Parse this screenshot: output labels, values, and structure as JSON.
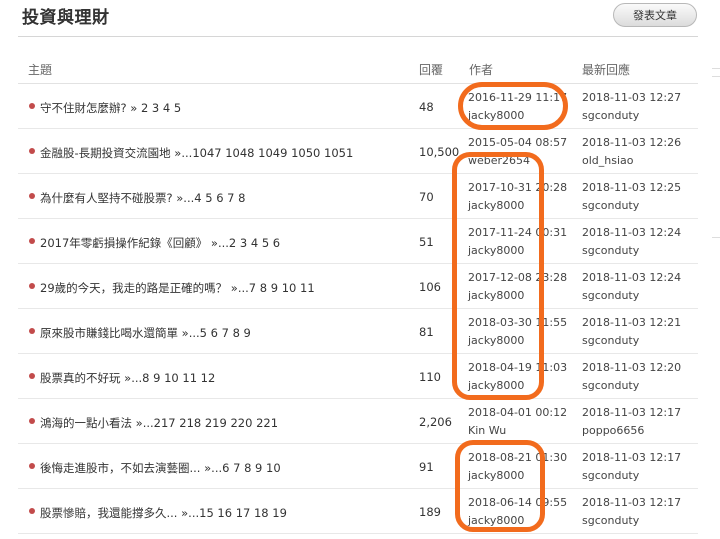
{
  "forum": {
    "title": "投資與理財",
    "post_button": "發表文章"
  },
  "columns": {
    "topic": "主題",
    "replies": "回覆",
    "author": "作者",
    "latest": "最新回應"
  },
  "threads": [
    {
      "title": "守不住財怎麼辦?",
      "pages": " » 2 3 4 5",
      "replies": "48",
      "author_date": "2016-11-29 11:17",
      "author": "jacky8000",
      "last_date": "2018-11-03 12:27",
      "last_user": "sgconduty"
    },
    {
      "title": "金融股-長期投資交流園地",
      "pages": " »...1047 1048 1049 1050 1051",
      "replies": "10,500",
      "author_date": "2015-05-04 08:57",
      "author": "weber2654",
      "last_date": "2018-11-03 12:26",
      "last_user": "old_hsiao"
    },
    {
      "title": "為什麼有人堅持不碰股票?",
      "pages": " »...4 5 6 7 8",
      "replies": "70",
      "author_date": "2017-10-31 20:28",
      "author": "jacky8000",
      "last_date": "2018-11-03 12:25",
      "last_user": "sgconduty"
    },
    {
      "title": "2017年零虧損操作紀錄《回顧》",
      "pages": " »...2 3 4 5 6",
      "replies": "51",
      "author_date": "2017-11-24 00:31",
      "author": "jacky8000",
      "last_date": "2018-11-03 12:24",
      "last_user": "sgconduty"
    },
    {
      "title": "29歲的今天，我走的路是正確的嗎？",
      "pages": " »...7 8 9 10 11",
      "replies": "106",
      "author_date": "2017-12-08 23:28",
      "author": "jacky8000",
      "last_date": "2018-11-03 12:24",
      "last_user": "sgconduty"
    },
    {
      "title": "原來股市賺錢比喝水還簡單",
      "pages": " »...5 6 7 8 9",
      "replies": "81",
      "author_date": "2018-03-30 11:55",
      "author": "jacky8000",
      "last_date": "2018-11-03 12:21",
      "last_user": "sgconduty"
    },
    {
      "title": "股票真的不好玩",
      "pages": " »...8 9 10 11 12",
      "replies": "110",
      "author_date": "2018-04-19 11:03",
      "author": "jacky8000",
      "last_date": "2018-11-03 12:20",
      "last_user": "sgconduty"
    },
    {
      "title": "鴻海的一點小看法",
      "pages": " »...217 218 219 220 221",
      "replies": "2,206",
      "author_date": "2018-04-01 00:12",
      "author": "Kin Wu",
      "last_date": "2018-11-03 12:17",
      "last_user": "poppo6656"
    },
    {
      "title": "後悔走進股市，不如去演藝圈...",
      "pages": " »...6 7 8 9 10",
      "replies": "91",
      "author_date": "2018-08-21 01:30",
      "author": "jacky8000",
      "last_date": "2018-11-03 12:17",
      "last_user": "sgconduty"
    },
    {
      "title": "股票慘賠，我還能撐多久...",
      "pages": " »...15 16 17 18 19",
      "replies": "189",
      "author_date": "2018-06-14 09:55",
      "author": "jacky8000",
      "last_date": "2018-11-03 12:17",
      "last_user": "sgconduty"
    }
  ],
  "colors": {
    "annotation_marker": "#f26b1d",
    "bullet": "#c24b4b"
  }
}
